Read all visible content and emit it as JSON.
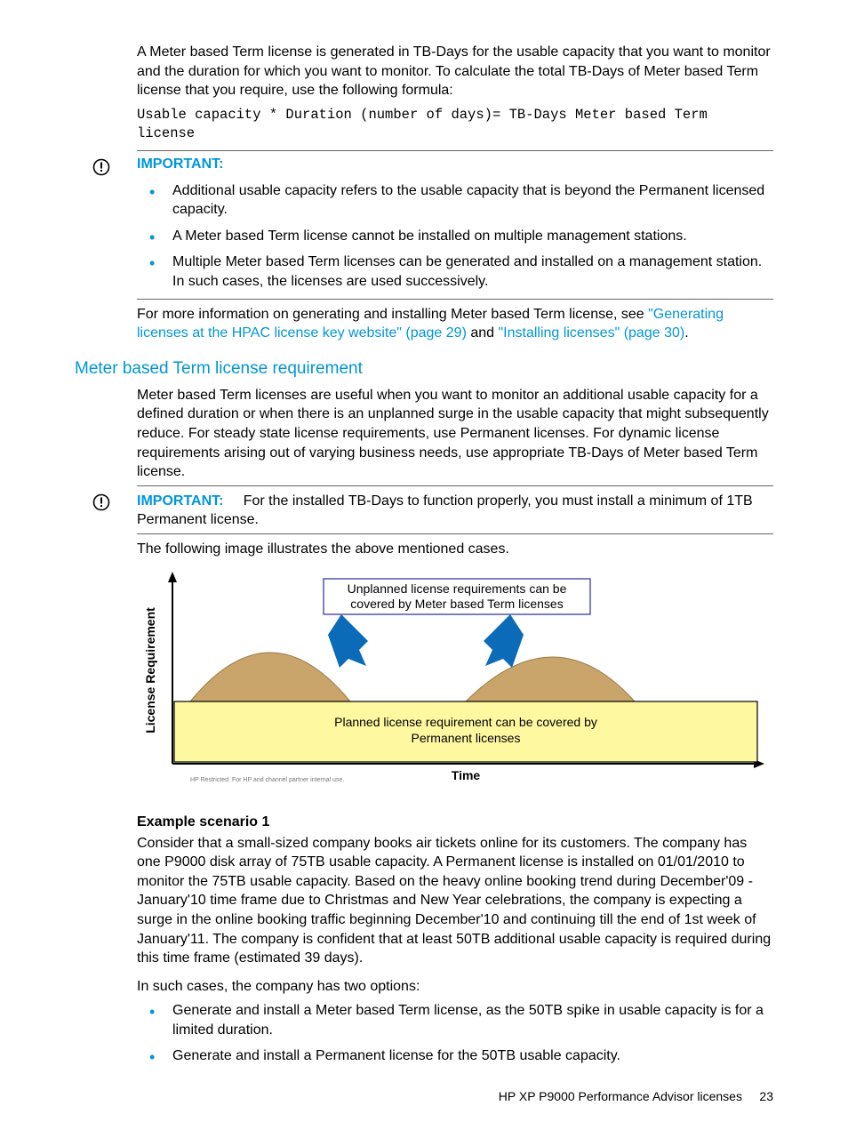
{
  "intro": {
    "p1": "A Meter based Term license is generated in TB-Days for the usable capacity that you want to monitor and the duration for which you want to monitor. To calculate the total TB-Days of Meter based Term license that you require, use the following formula:",
    "code": "Usable capacity * Duration (number of days)= TB-Days Meter based Term license"
  },
  "important1": {
    "label": "IMPORTANT:",
    "bullets": [
      "Additional usable capacity refers to the usable capacity that is beyond the Permanent licensed capacity.",
      "A Meter based Term license cannot be installed on multiple management stations.",
      "Multiple Meter based Term licenses can be generated and installed on a management station. In such cases, the licenses are used successively."
    ]
  },
  "moreinfo": {
    "prefix": "For more information on generating and installing Meter based Term license, see ",
    "link1": "\"Generating licenses at the HPAC license key website\" (page 29)",
    "mid": " and ",
    "link2": "\"Installing licenses\" (page 30)",
    "suffix": "."
  },
  "section": {
    "heading": "Meter based Term license requirement",
    "p1": "Meter based Term licenses are useful when you want to monitor an additional usable capacity for a defined duration or when there is an unplanned surge in the usable capacity that might subsequently reduce. For steady state license requirements, use Permanent licenses. For dynamic license requirements arising out of varying business needs, use appropriate TB-Days of Meter based Term license."
  },
  "important2": {
    "label": "IMPORTANT:",
    "text": "For the installed TB-Days to function properly, you must install a minimum of 1TB Permanent license."
  },
  "illustration_intro": "The following image illustrates the above mentioned cases.",
  "diagram": {
    "ylabel": "License Requirement",
    "xlabel": "Time",
    "callout_top": "Unplanned license requirements can be covered by Meter based Term licenses",
    "callout_bottom": "Planned license requirement can be covered by Permanent licenses",
    "footnote": "HP Restricted. For HP and channel partner internal use."
  },
  "example": {
    "heading": "Example scenario 1",
    "p1": "Consider that a small-sized company books air tickets online for its customers. The company has one P9000 disk array of 75TB usable capacity. A Permanent license is installed on 01/01/2010 to monitor the 75TB usable capacity. Based on the heavy online booking trend during December'09 - January'10 time frame due to Christmas and New Year celebrations, the company is expecting a surge in the online booking traffic beginning December'10 and continuing till the end of 1st week of January'11. The company is confident that at least 50TB additional usable capacity is required during this time frame (estimated 39 days).",
    "p2": "In such cases, the company has two options:",
    "bullets": [
      "Generate and install a Meter based Term license, as the 50TB spike in usable capacity is for a limited duration.",
      "Generate and install a Permanent license for the 50TB usable capacity."
    ]
  },
  "footer": {
    "title": "HP XP P9000 Performance Advisor licenses",
    "page": "23"
  }
}
